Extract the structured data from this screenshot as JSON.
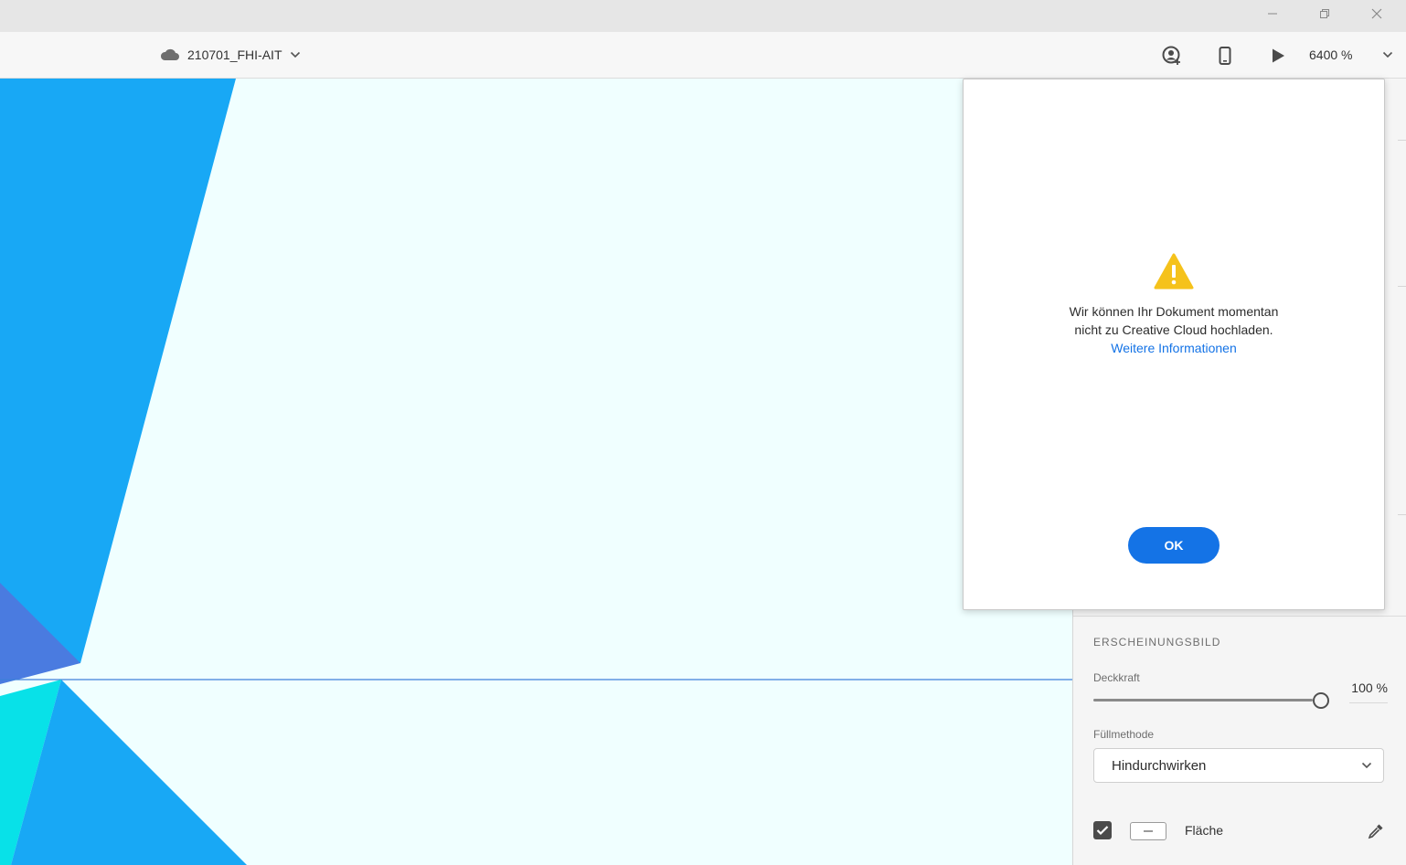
{
  "window": {
    "minimize_label": "—",
    "restore_label": "❐",
    "close_label": "✕"
  },
  "toolbar": {
    "document_name": "210701_FHI-AIT",
    "zoom_value": "6400 %"
  },
  "icons": {
    "cloud": "cloud-icon",
    "share": "share-user-icon",
    "device": "mobile-device-icon",
    "play": "play-icon",
    "warning": "warning-icon",
    "eyedropper": "eyedropper-icon"
  },
  "colors": {
    "canvas_background": "#f0ffff",
    "shape_blue": "#18a8f5",
    "shape_indigo": "#4a7be0",
    "shape_cyan": "#08e1e8",
    "accent": "#1473e6",
    "warning": "#f5c21b"
  },
  "panel": {
    "appearance_title": "ERSCHEINUNGSBILD",
    "opacity_label": "Deckkraft",
    "opacity_value": "100 %",
    "opacity_percent": 100,
    "blend_mode_label": "Füllmethode",
    "blend_mode_value": "Hindurchwirken",
    "fill_label": "Fläche",
    "fill_checked": true
  },
  "dialog": {
    "message_line1": "Wir können Ihr Dokument momentan",
    "message_line2": "nicht zu Creative Cloud hochladen.",
    "link_text": "Weitere Informationen",
    "ok_label": "OK"
  }
}
